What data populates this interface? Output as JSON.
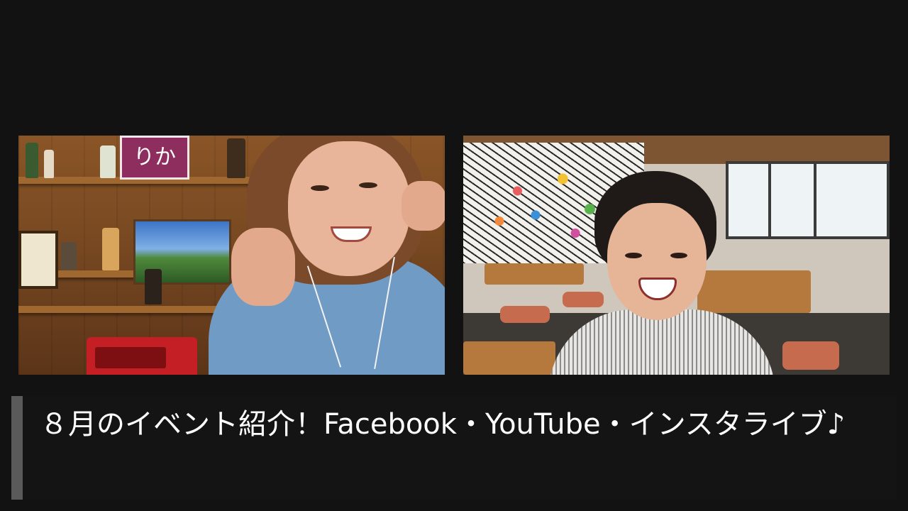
{
  "video_call": {
    "participants": [
      {
        "name_hint": "participant-left"
      },
      {
        "name_hint": "participant-right"
      }
    ],
    "left_sign_text": "りか"
  },
  "caption": {
    "text": "８月のイベント紹介！Facebook・YouTube・インスタライブ♪"
  },
  "colors": {
    "background": "#121212",
    "caption_bg": "#141414",
    "caption_accent": "#5a5a5a",
    "caption_text": "#ffffff"
  }
}
